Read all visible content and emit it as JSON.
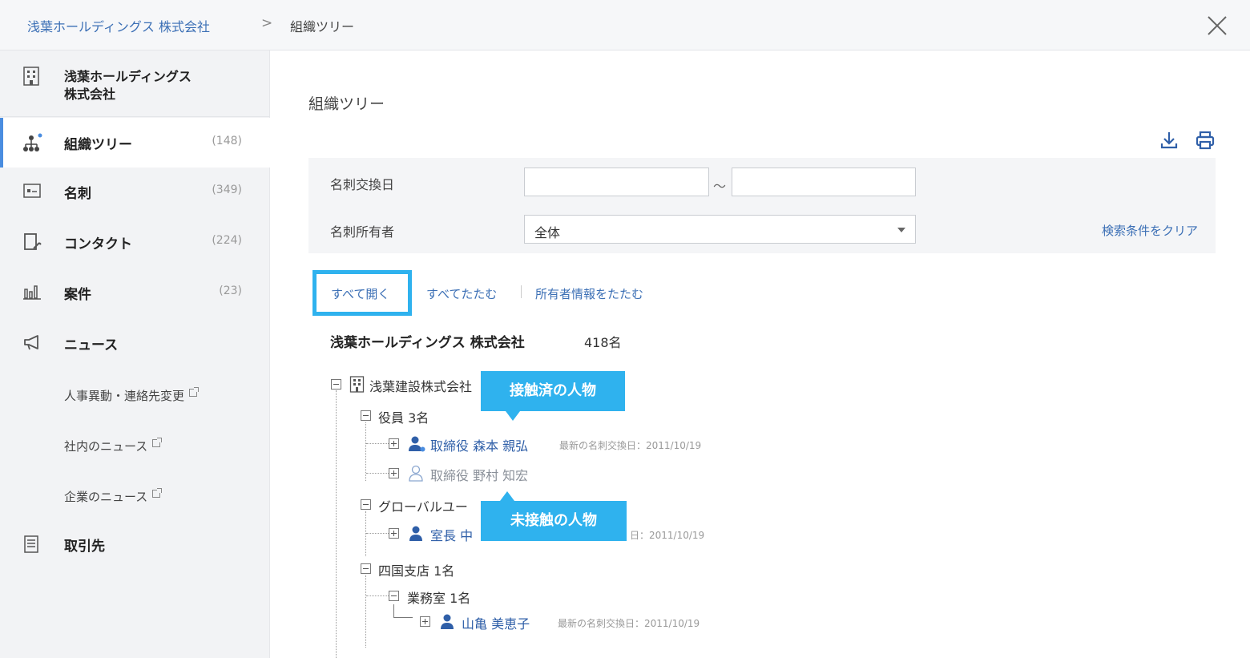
{
  "breadcrumb": {
    "parent": "浅葉ホールディングス 株式会社",
    "separator": ">",
    "current": "組織ツリー"
  },
  "sidebar": {
    "company": "浅葉ホールディングス\n株式会社",
    "items": [
      {
        "label": "組織ツリー",
        "count": "(148)",
        "icon": "org-tree-icon",
        "active": true
      },
      {
        "label": "名刺",
        "count": "(349)",
        "icon": "business-card-icon"
      },
      {
        "label": "コンタクト",
        "count": "(224)",
        "icon": "contact-icon"
      },
      {
        "label": "案件",
        "count": "(23)",
        "icon": "bar-chart-icon"
      },
      {
        "label": "ニュース",
        "count": "",
        "icon": "megaphone-icon"
      }
    ],
    "news_subitems": [
      "人事異動・連絡先変更",
      "社内のニュース",
      "企業のニュース"
    ],
    "partners": "取引先"
  },
  "main": {
    "title": "組織ツリー",
    "filters": {
      "date_label": "名刺交換日",
      "date_from": "",
      "date_to": "",
      "tilde": "〜",
      "owner_label": "名刺所有者",
      "owner_value": "全体",
      "clear": "検索条件をクリア"
    },
    "actions": {
      "expand_all": "すべて開く",
      "collapse_all": "すべてたたむ",
      "collapse_owner": "所有者情報をたたむ"
    },
    "tree": {
      "root_name": "浅葉ホールディングス 株式会社",
      "root_count": "418名",
      "subsidiary": "浅葉建設株式会社",
      "dept_officers": "役員 3名",
      "person1": "取締役 森本 親弘",
      "person1_date": "最新の名刺交換日：2011/10/19",
      "person2": "取締役 野村 知宏",
      "dept_global": "グローバルユー",
      "person3": "室長 中",
      "person3_date": "日：2011/10/19",
      "dept_shikoku": "四国支店 1名",
      "dept_gyomu": "業務室 1名",
      "person4": "山亀 美恵子",
      "person4_date": "最新の名刺交換日：2011/10/19"
    },
    "tooltips": {
      "contacted": "接触済の人物",
      "uncontacted": "未接触の人物"
    }
  },
  "colors": {
    "accent": "#2fb2ee",
    "link": "#3b6fb5",
    "person": "#2f5fa8",
    "active_bar": "#4a8de0"
  }
}
